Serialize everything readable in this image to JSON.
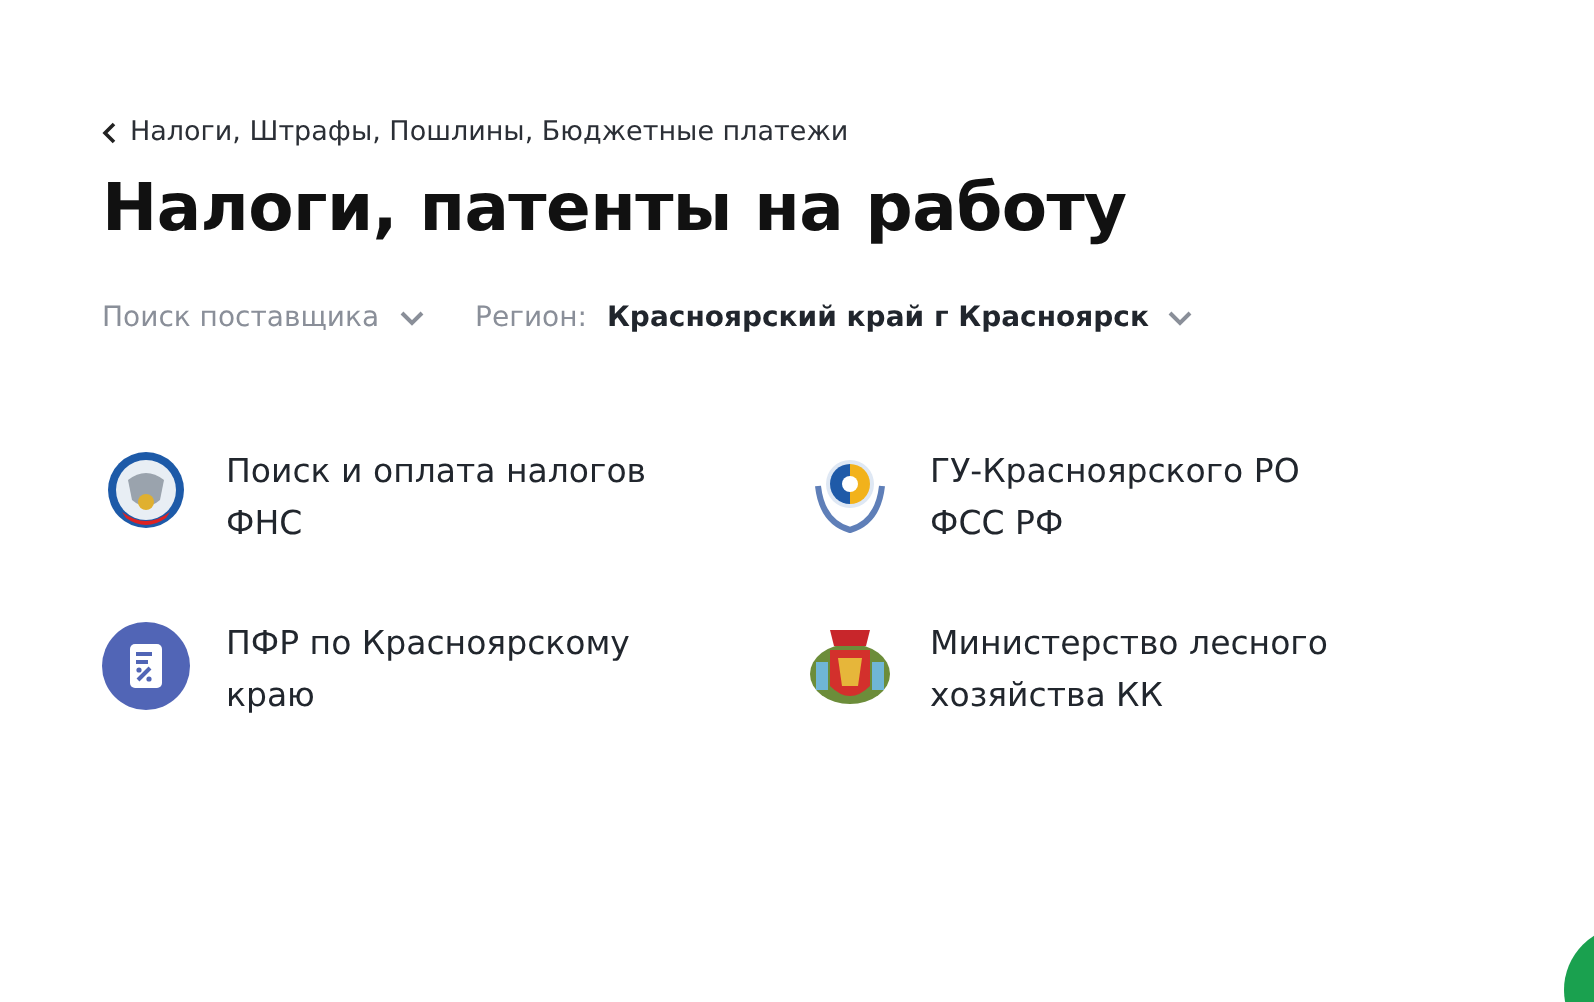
{
  "breadcrumb": {
    "label": "Налоги, Штрафы, Пошлины, Бюджетные платежи"
  },
  "title": "Налоги, патенты на работу",
  "filters": [
    {
      "kind": "plain",
      "label": "Поиск поставщика"
    },
    {
      "kind": "labeled",
      "label": "Регион:",
      "value": "Красноярский край г Красноярск"
    }
  ],
  "providers": [
    {
      "kind": "eagle",
      "name": "Поиск и оплата налогов ФНС"
    },
    {
      "kind": "fss",
      "name": "ГУ-Красноярского РО ФСС РФ"
    },
    {
      "kind": "document",
      "name": "ПФР по Красноярскому краю"
    },
    {
      "kind": "crest",
      "name": "Министерство лесного хозяйства КК"
    }
  ]
}
